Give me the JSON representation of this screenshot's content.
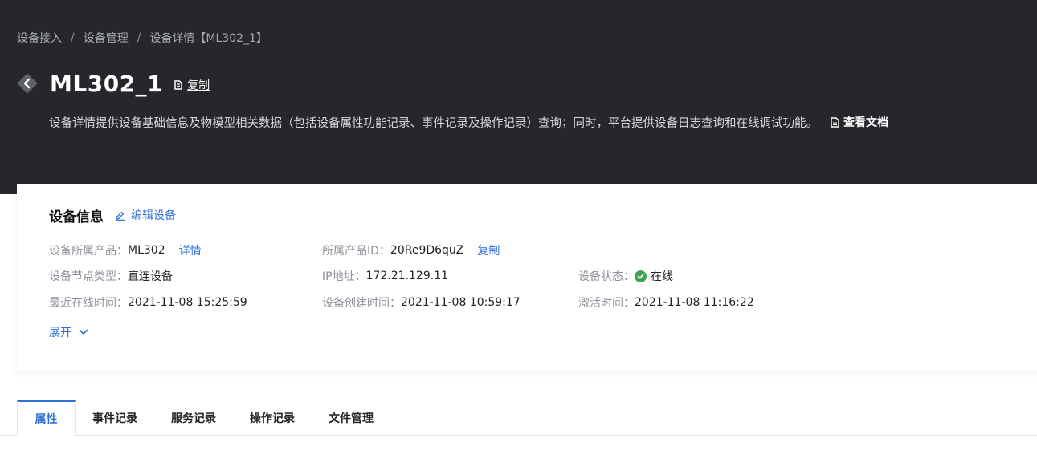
{
  "breadcrumb": {
    "items": [
      "设备接入",
      "设备管理",
      "设备详情【ML302_1】"
    ],
    "separator": "/"
  },
  "header": {
    "title": "ML302_1",
    "copy_label": "复制",
    "description": "设备详情提供设备基础信息及物模型相关数据（包括设备属性功能记录、事件记录及操作记录）查询；同时，平台提供设备日志查询和在线调试功能。",
    "doc_link": "查看文档"
  },
  "device_info": {
    "title": "设备信息",
    "edit_label": "编辑设备",
    "product": {
      "label": "设备所属产品：",
      "value": "ML302",
      "link": "详情"
    },
    "product_id": {
      "label": "所属产品ID：",
      "value": "20Re9D6quZ",
      "link": "复制"
    },
    "node_type": {
      "label": "设备节点类型：",
      "value": "直连设备"
    },
    "ip": {
      "label": "IP地址：",
      "value": "172.21.129.11"
    },
    "status": {
      "label": "设备状态：",
      "value": "在线"
    },
    "last_online": {
      "label": "最近在线时间：",
      "value": "2021-11-08 15:25:59"
    },
    "created": {
      "label": "设备创建时间：",
      "value": "2021-11-08 10:59:17"
    },
    "activated": {
      "label": "激活时间：",
      "value": "2021-11-08 11:16:22"
    },
    "expand_label": "展开"
  },
  "tabs": [
    {
      "label": "属性",
      "active": true
    },
    {
      "label": "事件记录",
      "active": false
    },
    {
      "label": "服务记录",
      "active": false
    },
    {
      "label": "操作记录",
      "active": false
    },
    {
      "label": "文件管理",
      "active": false
    }
  ],
  "colors": {
    "header_bg": "#26272b",
    "accent": "#2f6fd6",
    "online": "#3fa454"
  },
  "icons": [
    "back-arrow-icon",
    "copy-icon",
    "document-icon",
    "edit-pencil-icon",
    "check-circle-icon",
    "chevron-down-icon"
  ]
}
